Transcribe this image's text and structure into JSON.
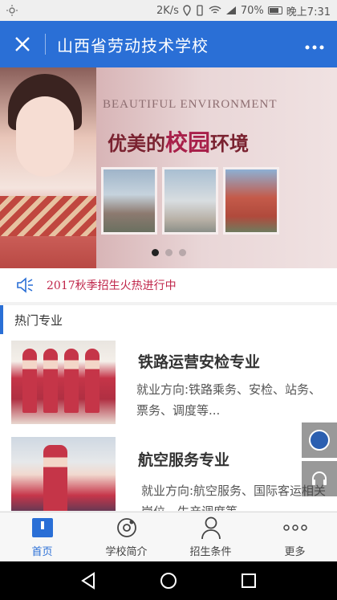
{
  "statusbar": {
    "net_speed": "2K/s",
    "battery": "70%",
    "time": "晚上7:31"
  },
  "titlebar": {
    "title": "山西省劳动技术学校"
  },
  "banner": {
    "heading_en": "BEAUTIFUL ENVIRONMENT",
    "heading_cn_prefix": "优美的",
    "heading_cn_big": "校园",
    "heading_cn_suffix": "环境",
    "slide_count": 3,
    "active_slide": 1
  },
  "notice": {
    "text": "2017秋季招生火热进行中"
  },
  "section": {
    "title": "热门专业"
  },
  "majors": [
    {
      "name": "铁路运营安检专业",
      "desc": "就业方向:铁路乘务、安检、站务、票务、调度等..."
    },
    {
      "name": "航空服务专业",
      "desc": "就业方向:航空服务、国际客运相关岗位、生产调度等..."
    }
  ],
  "tabbar": {
    "tabs": [
      {
        "label": "首页",
        "icon": "home-icon",
        "active": true
      },
      {
        "label": "学校简介",
        "icon": "school-info-icon",
        "active": false
      },
      {
        "label": "招生条件",
        "icon": "person-icon",
        "active": false
      },
      {
        "label": "更多",
        "icon": "more-dots-icon",
        "active": false
      }
    ]
  },
  "colors": {
    "primary": "#2a6fd6",
    "notice_text": "#c0264a"
  }
}
